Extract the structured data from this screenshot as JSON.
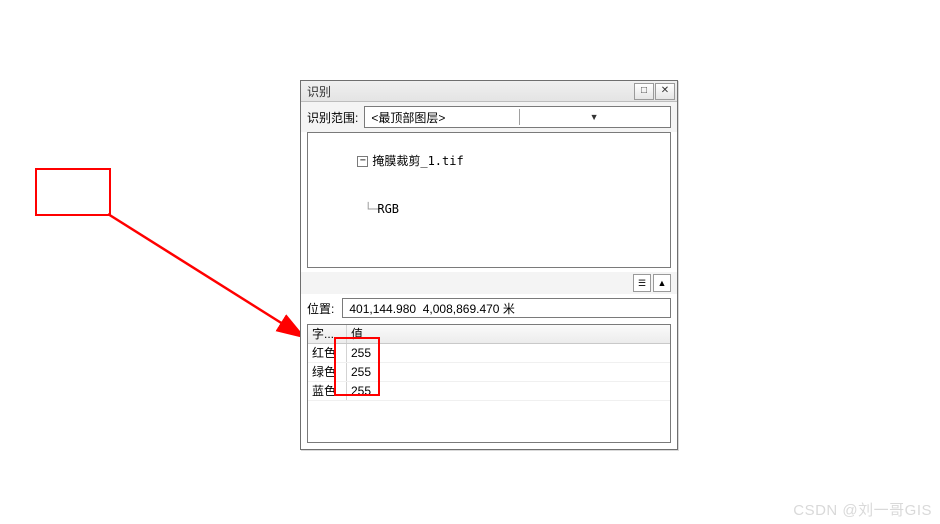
{
  "dialog": {
    "title": "识别",
    "scope_label": "识别范围:",
    "scope_value": "<最顶部图层>",
    "tree": {
      "root": "掩膜裁剪_1.tif",
      "child": "RGB"
    },
    "location_label": "位置:",
    "location_value": "401,144.980  4,008,869.470 米",
    "columns": {
      "field": "字...",
      "value": "值"
    },
    "rows": [
      {
        "field": "红色",
        "value": "255"
      },
      {
        "field": "绿色",
        "value": "255"
      },
      {
        "field": "蓝色",
        "value": "255"
      }
    ],
    "buttons": {
      "pin": "□",
      "close": "✕",
      "dropdown": "▼",
      "collapse": "−",
      "info": "☰",
      "up": "▲"
    }
  },
  "watermark": "CSDN @刘一哥GIS"
}
